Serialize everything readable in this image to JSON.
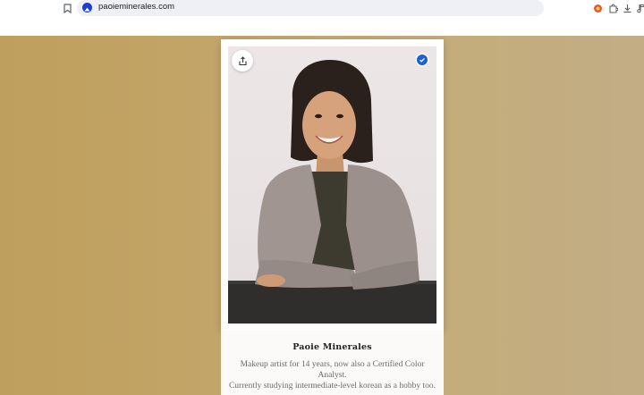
{
  "browser": {
    "url": "paoieminerales.com",
    "icons": [
      "bookmark-icon",
      "site-info-icon",
      "extension-icon",
      "puzzle-icon",
      "download-icon",
      "music-icon"
    ]
  },
  "profile": {
    "name": "Paoie Minerales",
    "bio_line1": "Makeup artist for 14 years, now also a Certified Color Analyst.",
    "bio_line2": "Currently studying intermediate-level korean as a hobby too.",
    "verified": true
  },
  "colors": {
    "background_gold": "#c3a66c",
    "verified_blue": "#1e5fd6"
  }
}
